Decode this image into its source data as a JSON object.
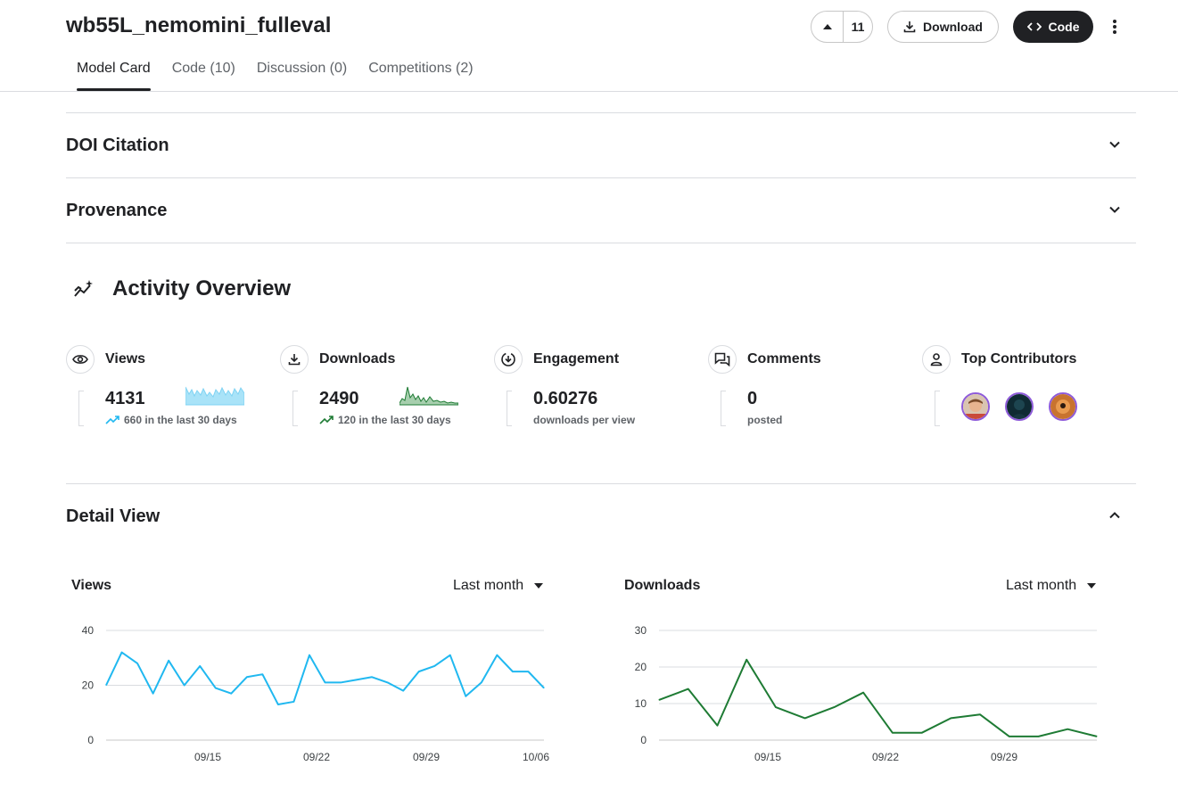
{
  "header": {
    "title": "wb55L_nemomini_fulleval",
    "vote_count": "11",
    "download_label": "Download",
    "code_label": "Code"
  },
  "tabs": [
    {
      "label": "Model Card",
      "active": true
    },
    {
      "label": "Code (10)"
    },
    {
      "label": "Discussion (0)"
    },
    {
      "label": "Competitions (2)"
    }
  ],
  "sections": {
    "doi": "DOI Citation",
    "provenance": "Provenance",
    "activity": "Activity Overview",
    "detail": "Detail View"
  },
  "stats": {
    "views": {
      "label": "Views",
      "value": "4131",
      "sub": "660 in the last 30 days",
      "icon": "eye-icon"
    },
    "downloads": {
      "label": "Downloads",
      "value": "2490",
      "sub": "120 in the last 30 days",
      "icon": "download-icon"
    },
    "engagement": {
      "label": "Engagement",
      "value": "0.60276",
      "sub": "downloads per view",
      "icon": "engagement-icon"
    },
    "comments": {
      "label": "Comments",
      "value": "0",
      "sub": "posted",
      "icon": "comment-icon"
    },
    "contributors": {
      "label": "Top Contributors",
      "icon": "person-icon",
      "count": 3
    }
  },
  "colors": {
    "views": "#20b8f0",
    "downloads": "#1e7b34",
    "avatar_ring": "#8e5bd9"
  },
  "detail": {
    "views_title": "Views",
    "views_range": "Last month",
    "downloads_title": "Downloads",
    "downloads_range": "Last month"
  },
  "chart_data": [
    {
      "type": "line",
      "title": "Views",
      "x_ticks": [
        "09/15",
        "09/22",
        "09/29",
        "10/06"
      ],
      "y_ticks": [
        0,
        20,
        40
      ],
      "ylim": [
        0,
        40
      ],
      "grid": true,
      "series": [
        {
          "values": [
            20,
            32,
            28,
            17,
            29,
            20,
            27,
            19,
            17,
            23,
            24,
            13,
            14,
            31,
            21,
            21,
            22,
            23,
            21,
            18,
            25,
            27,
            31,
            16,
            21,
            31,
            25,
            25,
            19
          ]
        }
      ]
    },
    {
      "type": "line",
      "title": "Downloads",
      "x_ticks": [
        "09/15",
        "09/22",
        "09/29"
      ],
      "y_ticks": [
        0,
        10,
        20,
        30
      ],
      "ylim": [
        0,
        30
      ],
      "grid": true,
      "series": [
        {
          "values": [
            11,
            14,
            4,
            22,
            9,
            6,
            9,
            13,
            2,
            2,
            6,
            7,
            1,
            1,
            3,
            1
          ]
        }
      ]
    }
  ]
}
